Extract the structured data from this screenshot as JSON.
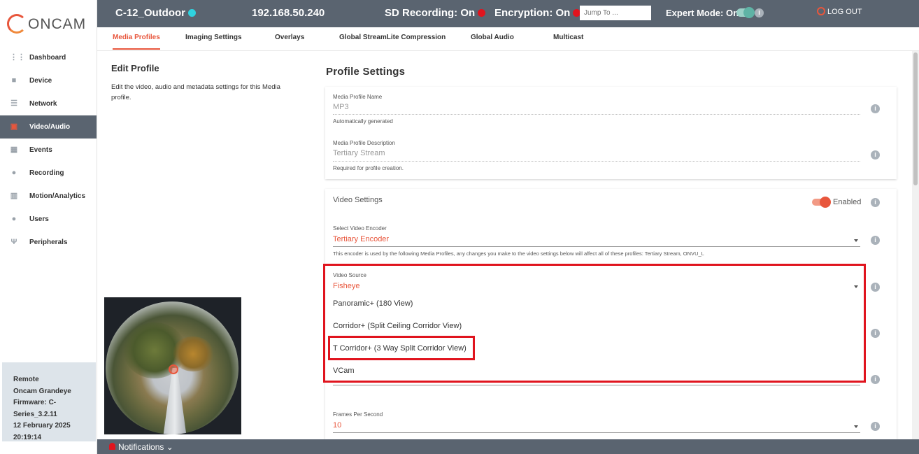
{
  "header": {
    "camera_name": "C-12_Outdoor",
    "ip": "192.168.50.240",
    "sd_recording": "SD Recording: On",
    "encryption": "Encryption: On",
    "jump_placeholder": "Jump To ...",
    "expert_mode": "Expert Mode: On",
    "logout": "LOG OUT",
    "colors": {
      "bar": "#5a6470",
      "status_online": "#2fd3e0",
      "status_red": "#e0141e",
      "accent": "#e8563c"
    }
  },
  "logo": {
    "text": "ONCAM"
  },
  "sidebar": {
    "items": [
      {
        "label": "Dashboard",
        "icon": "grid-icon",
        "glyph": "⋮⋮"
      },
      {
        "label": "Device",
        "icon": "camera-icon",
        "glyph": "■"
      },
      {
        "label": "Network",
        "icon": "server-icon",
        "glyph": "☰"
      },
      {
        "label": "Video/Audio",
        "icon": "video-icon",
        "glyph": "▣",
        "active": true
      },
      {
        "label": "Events",
        "icon": "calendar-icon",
        "glyph": "▦"
      },
      {
        "label": "Recording",
        "icon": "record-icon",
        "glyph": "●"
      },
      {
        "label": "Motion/Analytics",
        "icon": "analytics-icon",
        "glyph": "▥"
      },
      {
        "label": "Users",
        "icon": "user-icon",
        "glyph": "●"
      },
      {
        "label": "Peripherals",
        "icon": "usb-icon",
        "glyph": "Ψ"
      }
    ],
    "device_info": [
      "Remote",
      "Oncam Grandeye",
      "Firmware: C-",
      "Series_3.2.11",
      "12 February 2025",
      "20:19:14"
    ]
  },
  "tabs": [
    {
      "label": "Media Profiles",
      "active": true
    },
    {
      "label": "Imaging Settings"
    },
    {
      "label": "Overlays"
    },
    {
      "label": "Global StreamLite Compression"
    },
    {
      "label": "Global Audio"
    },
    {
      "label": "Multicast"
    }
  ],
  "edit_profile": {
    "title": "Edit Profile",
    "description": "Edit the video, audio and metadata settings for this Media profile."
  },
  "profile_settings": {
    "title": "Profile Settings",
    "name_label": "Media Profile Name",
    "name_value": "MP3",
    "name_help": "Automatically generated",
    "desc_label": "Media Profile Description",
    "desc_value": "Tertiary Stream",
    "desc_help": "Required for profile creation."
  },
  "video_settings": {
    "title": "Video Settings",
    "enabled_label": "Enabled",
    "encoder_label": "Select Video Encoder",
    "encoder_value": "Tertiary Encoder",
    "encoder_help": "This encoder is used by the following Media Profiles, any changes you make to the video settings below will affect all of these profiles: Tertiary Stream, ONVU_L",
    "source_label": "Video Source",
    "source_value": "Fisheye",
    "source_options": [
      "Panoramic+ (180 View)",
      "Corridor+ (Split Ceiling Corridor View)",
      "T Corridor+ (3 Way Split Corridor View)",
      "VCam"
    ],
    "fps_label": "Frames Per Second",
    "fps_value": "10"
  },
  "footer": {
    "notifications": "Notifications ⌄"
  }
}
